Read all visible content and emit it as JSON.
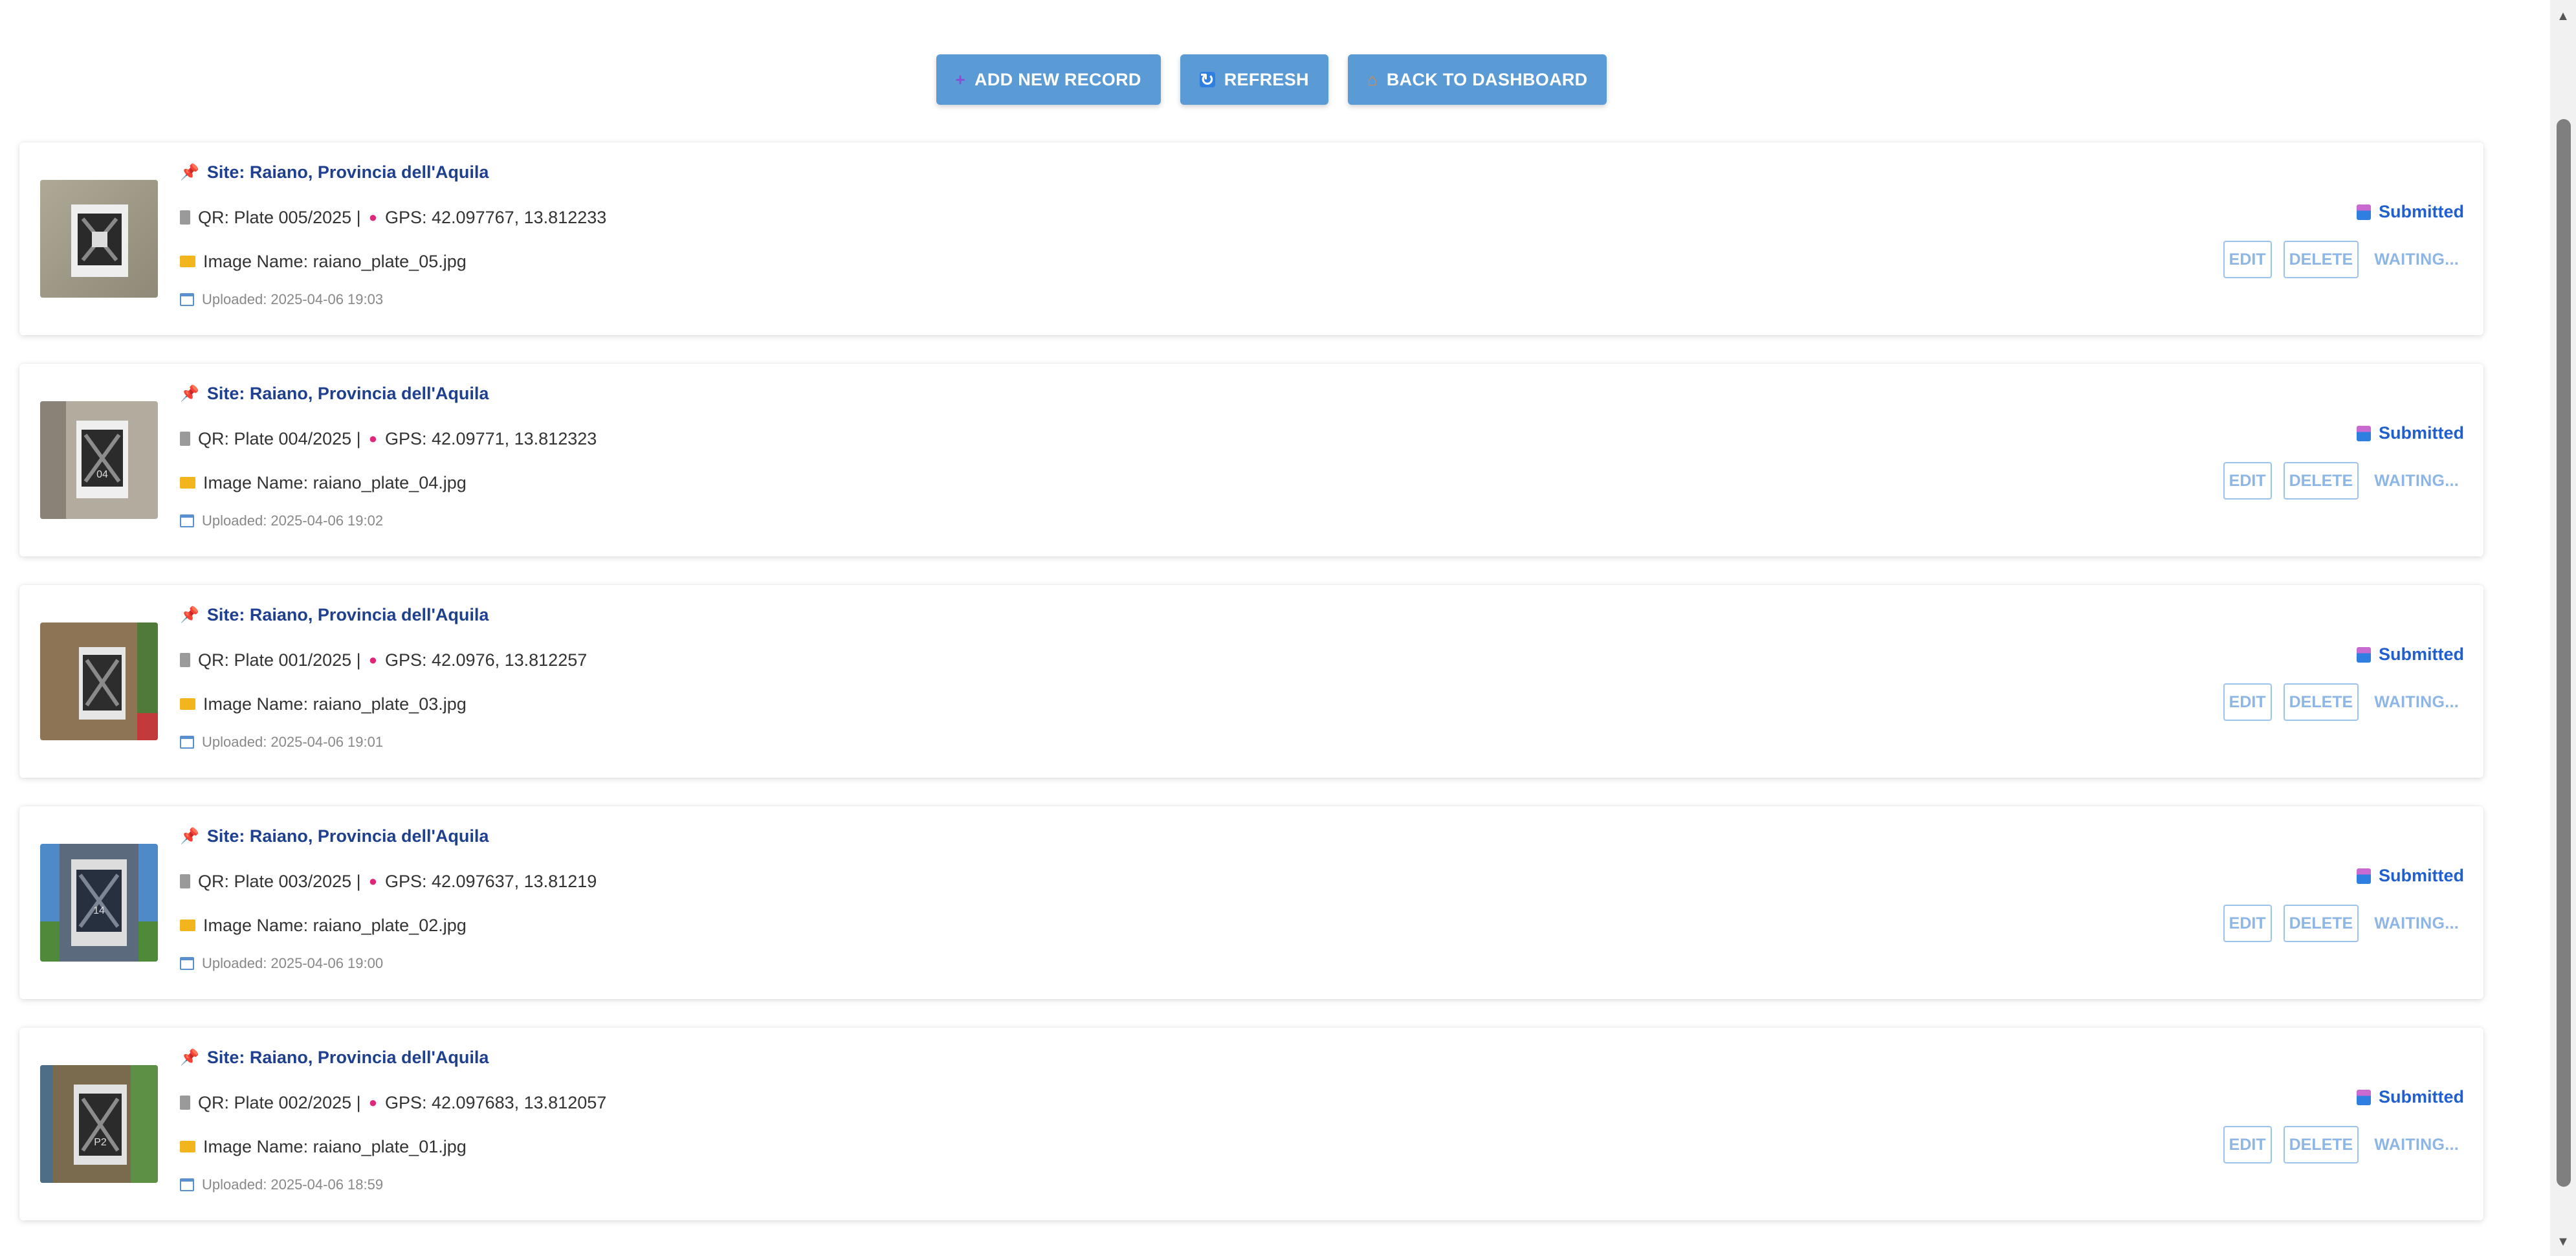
{
  "toolbar": {
    "add_label": "ADD NEW RECORD",
    "refresh_label": "REFRESH",
    "back_label": "BACK TO DASHBOARD"
  },
  "records": [
    {
      "site": "Site: Raiano, Provincia dell'Aquila",
      "qr": "QR: Plate 005/2025 |",
      "gps": "GPS: 42.097767, 13.812233",
      "image_name": "Image Name: raiano_plate_05.jpg",
      "uploaded": "Uploaded: 2025-04-06 19:03",
      "status": "Submitted",
      "edit": "EDIT",
      "delete": "DELETE",
      "waiting": "WAITING...",
      "photo_bg": "#a09a87",
      "plate_label": ""
    },
    {
      "site": "Site: Raiano, Provincia dell'Aquila",
      "qr": "QR: Plate 004/2025 |",
      "gps": "GPS: 42.09771, 13.812323",
      "image_name": "Image Name: raiano_plate_04.jpg",
      "uploaded": "Uploaded: 2025-04-06 19:02",
      "status": "Submitted",
      "edit": "EDIT",
      "delete": "DELETE",
      "waiting": "WAITING...",
      "photo_bg": "#b3ab9d",
      "plate_label": "04"
    },
    {
      "site": "Site: Raiano, Provincia dell'Aquila",
      "qr": "QR: Plate 001/2025 |",
      "gps": "GPS: 42.0976, 13.812257",
      "image_name": "Image Name: raiano_plate_03.jpg",
      "uploaded": "Uploaded: 2025-04-06 19:01",
      "status": "Submitted",
      "edit": "EDIT",
      "delete": "DELETE",
      "waiting": "WAITING...",
      "photo_bg": "#8d7454",
      "plate_label": ""
    },
    {
      "site": "Site: Raiano, Provincia dell'Aquila",
      "qr": "QR: Plate 003/2025 |",
      "gps": "GPS: 42.097637, 13.81219",
      "image_name": "Image Name: raiano_plate_02.jpg",
      "uploaded": "Uploaded: 2025-04-06 19:00",
      "status": "Submitted",
      "edit": "EDIT",
      "delete": "DELETE",
      "waiting": "WAITING...",
      "photo_bg": "#5c6a7e",
      "plate_label": "14"
    },
    {
      "site": "Site: Raiano, Provincia dell'Aquila",
      "qr": "QR: Plate 002/2025 |",
      "gps": "GPS: 42.097683, 13.812057",
      "image_name": "Image Name: raiano_plate_01.jpg",
      "uploaded": "Uploaded: 2025-04-06 18:59",
      "status": "Submitted",
      "edit": "EDIT",
      "delete": "DELETE",
      "waiting": "WAITING...",
      "photo_bg": "#7a6a4e",
      "plate_label": "P2"
    }
  ],
  "colors": {
    "button_bg": "#5b9bd5",
    "site_text": "#1f3f8f",
    "status_text": "#1f5fd0",
    "action_text": "#8db6e6"
  }
}
